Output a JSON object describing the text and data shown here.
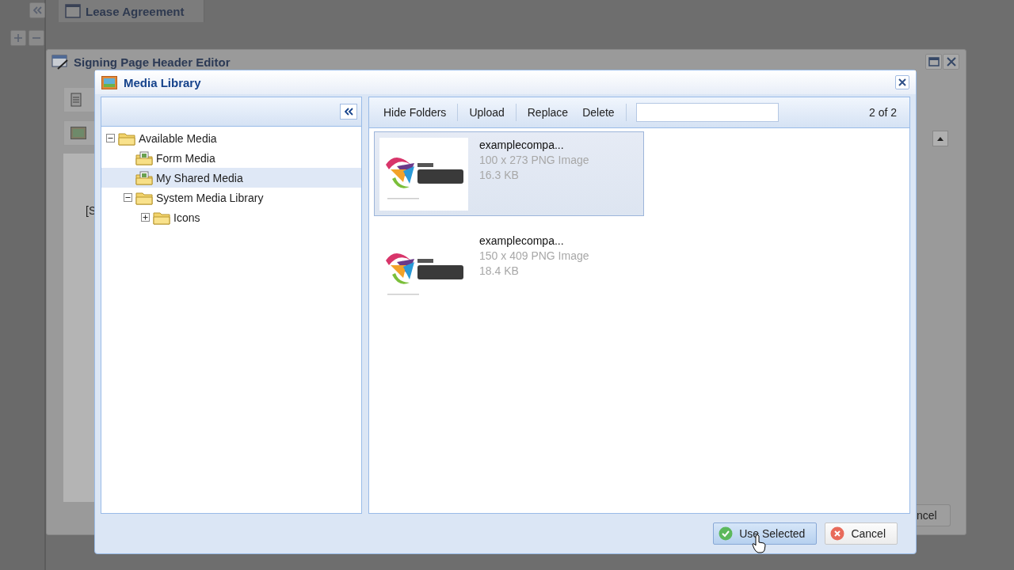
{
  "app": {
    "tab": "Lease Agreement"
  },
  "editor": {
    "title": "Signing Page Header Editor",
    "fragment_left": "[S",
    "fragment_button": "ncel"
  },
  "media_library": {
    "title": "Media Library",
    "tree": [
      {
        "label": "Available Media",
        "kind": "folder",
        "expanded": true,
        "selected": false,
        "children": [
          {
            "label": "Form Media",
            "kind": "image-folder",
            "selected": false
          },
          {
            "label": "My Shared Media",
            "kind": "image-folder",
            "selected": true
          },
          {
            "label": "System Media Library",
            "kind": "folder",
            "expanded": true,
            "selected": false,
            "children": [
              {
                "label": "Icons",
                "kind": "folder",
                "expanded": false,
                "selected": false
              }
            ]
          }
        ]
      }
    ],
    "toolbar": {
      "buttons": [
        "Hide Folders",
        "Upload",
        "Replace",
        "Delete"
      ],
      "count": "2 of 2"
    },
    "items": [
      {
        "name": "examplecompa...",
        "dimensions": "100 x 273 PNG Image",
        "size": "16.3 KB",
        "selected": true
      },
      {
        "name": "examplecompa...",
        "dimensions": "150 x 409 PNG Image",
        "size": "18.4 KB",
        "selected": false
      }
    ],
    "buttons": [
      {
        "label": "Use Selected",
        "kind": "confirm",
        "hovered": true
      },
      {
        "label": "Cancel",
        "kind": "cancel",
        "hovered": false
      }
    ]
  }
}
